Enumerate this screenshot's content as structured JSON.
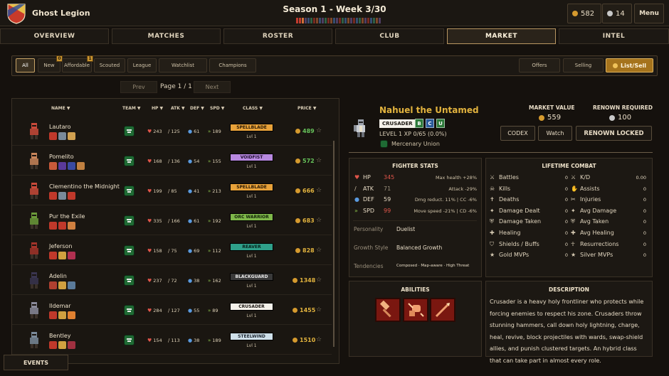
{
  "header": {
    "team_name": "Ghost Legion",
    "season_title": "Season 1 - Week 3/30",
    "gold": "582",
    "renown": "14",
    "menu_label": "Menu",
    "week_colors": [
      "#c23b2e",
      "#c23b2e",
      "#d0703a",
      "#7a5fa5",
      "#4a7bbf",
      "#3f9a6d",
      "#c23b2e",
      "#d0703a",
      "#4a7bbf",
      "#7a5fa5",
      "#3f9a6d",
      "#c23b2e",
      "#d0703a",
      "#4a7bbf",
      "#7a5fa5",
      "#c23b2e",
      "#3f9a6d",
      "#4a7bbf",
      "#d0703a",
      "#7a5fa5",
      "#c23b2e",
      "#4a7bbf",
      "#3f9a6d",
      "#d0703a",
      "#7a5fa5",
      "#c23b2e",
      "#4a7bbf",
      "#3f9a6d",
      "#d0703a",
      "#7a5fa5"
    ]
  },
  "tabs": [
    "OVERVIEW",
    "MATCHES",
    "ROSTER",
    "CLUB",
    "MARKET",
    "INTEL"
  ],
  "active_tab": "MARKET",
  "filters": {
    "all": "All",
    "new": "New",
    "new_badge": "0",
    "affordable": "Affordable",
    "affordable_badge": "1",
    "scouted": "Scouted",
    "league": "League",
    "watchlist": "Watchlist",
    "champions": "Champions",
    "offers": "Offers",
    "selling": "Selling",
    "list_sell": "List/Sell"
  },
  "pagination": {
    "prev": "Prev",
    "label": "Page 1 / 1",
    "next": "Next"
  },
  "table": {
    "headers": {
      "name": "NAME ▼",
      "team": "TEAM ▼",
      "hp": "HP ▼",
      "atk": "ATK ▼",
      "def": "DEF ▼",
      "spd": "SPD ▼",
      "class": "CLASS ▼",
      "price": "PRICE ▼"
    },
    "rows": [
      {
        "name": "Lautaro",
        "hp": "243",
        "atk": "125",
        "def": "61",
        "spd": "189",
        "class": "SPELLBLADE",
        "level": "Lvl 1",
        "price": "489",
        "class_color": "#e8a23a",
        "class_text": "#2a1a05",
        "price_color": "#66c25a",
        "skin": "#c94a3a"
      },
      {
        "name": "Pomelito",
        "hp": "168",
        "atk": "136",
        "def": "54",
        "spd": "155",
        "class": "VOIDFIST",
        "level": "Lvl 1",
        "price": "572",
        "class_color": "#b889e0",
        "class_text": "#1f0f30",
        "price_color": "#66c25a",
        "skin": "#c9855a"
      },
      {
        "name": "Clementino the Midnight",
        "hp": "199",
        "atk": "85",
        "def": "41",
        "spd": "213",
        "class": "SPELLBLADE",
        "level": "Lvl 1",
        "price": "666",
        "class_color": "#e8a23a",
        "class_text": "#2a1a05",
        "price_color": "#e2b33e",
        "skin": "#c94a3a"
      },
      {
        "name": "Pur the Exile",
        "hp": "335",
        "atk": "166",
        "def": "61",
        "spd": "192",
        "class": "ORC WARRIOR",
        "level": "Lvl 1",
        "price": "683",
        "class_color": "#7fb84a",
        "class_text": "#14250a",
        "price_color": "#e2b33e",
        "skin": "#6b9a3a"
      },
      {
        "name": "Jeferson",
        "hp": "158",
        "atk": "75",
        "def": "69",
        "spd": "112",
        "class": "REAVER",
        "level": "Lvl 1",
        "price": "828",
        "class_color": "#2fa08a",
        "class_text": "#06221c",
        "price_color": "#e2b33e",
        "skin": "#a3342a"
      },
      {
        "name": "Adelin",
        "hp": "237",
        "atk": "72",
        "def": "38",
        "spd": "162",
        "class": "BLACKGUARD",
        "level": "Lvl 1",
        "price": "1348",
        "class_color": "#3a3a3a",
        "class_text": "#e8e8e8",
        "price_color": "#e2b33e",
        "skin": "#3a3550"
      },
      {
        "name": "Ildemar",
        "hp": "284",
        "atk": "127",
        "def": "55",
        "spd": "89",
        "class": "CRUSADER",
        "level": "Lvl 1",
        "price": "1455",
        "class_color": "#f4f1ea",
        "class_text": "#1b1712",
        "price_color": "#e2b33e",
        "skin": "#8a8a9a"
      },
      {
        "name": "Bentley",
        "hp": "154",
        "atk": "113",
        "def": "38",
        "spd": "189",
        "class": "STEELWIND",
        "level": "Lvl 1",
        "price": "1510",
        "class_color": "#cfe0ea",
        "class_text": "#1b2530",
        "price_color": "#e2b33e",
        "skin": "#7a8a9a"
      }
    ]
  },
  "events_label": "EVENTS",
  "hero": {
    "name": "Nahuel the Untamed",
    "class": "CRUSADER",
    "grades": [
      "B",
      "C",
      "U"
    ],
    "level_line": "LEVEL 1  XP 0/65 (0.0%)",
    "team": "Mercenary Union",
    "market_value_label": "MARKET VALUE",
    "market_value": "559",
    "renown_label": "RENOWN REQUIRED",
    "renown": "100",
    "codex": "CODEX",
    "watch": "Watch",
    "renown_locked": "RENOWN LOCKED"
  },
  "fighter_stats": {
    "title": "FIGHTER STATS",
    "rows": [
      {
        "label": "HP",
        "value": "345",
        "note": "Max health +28%",
        "color": "#e0554a"
      },
      {
        "label": "ATK",
        "value": "71",
        "note": "Attack -29%",
        "color": "#9a8f7c"
      },
      {
        "label": "DEF",
        "value": "59",
        "note": "Dmg reduct. 11% | CC -6%",
        "color": "#e8dcc6"
      },
      {
        "label": "SPD",
        "value": "99",
        "note": "Move speed -21% | CD -6%",
        "color": "#e0554a"
      }
    ],
    "personality_label": "Personality",
    "personality": "Duelist",
    "growth_label": "Growth Style",
    "growth": "Balanced Growth",
    "tendencies_label": "Tendencies",
    "tendencies": "Composed · Map-aware · High Threat"
  },
  "lifetime": {
    "title": "LIFETIME COMBAT",
    "left": [
      {
        "label": "Battles",
        "value": "0",
        "icon": "⚔"
      },
      {
        "label": "Kills",
        "value": "0",
        "icon": "☠"
      },
      {
        "label": "Deaths",
        "value": "0",
        "icon": "✝"
      },
      {
        "label": "Damage Dealt",
        "value": "0",
        "icon": "✦"
      },
      {
        "label": "Damage Taken",
        "value": "0",
        "icon": "⛨"
      },
      {
        "label": "Healing",
        "value": "0",
        "icon": "✚"
      },
      {
        "label": "Shields / Buffs",
        "value": "0",
        "icon": "⛉"
      },
      {
        "label": "Gold MVPs",
        "value": "0",
        "icon": "★"
      }
    ],
    "right": [
      {
        "label": "K/D",
        "value": "0.00",
        "icon": "⚔"
      },
      {
        "label": "Assists",
        "value": "0",
        "icon": "✋"
      },
      {
        "label": "Injuries",
        "value": "0",
        "icon": "✂"
      },
      {
        "label": "Avg Damage",
        "value": "0",
        "icon": "✦"
      },
      {
        "label": "Avg Taken",
        "value": "0",
        "icon": "⛨"
      },
      {
        "label": "Avg Healing",
        "value": "0",
        "icon": "✚"
      },
      {
        "label": "Resurrections",
        "value": "0",
        "icon": "☥"
      },
      {
        "label": "Silver MVPs",
        "value": "0",
        "icon": "★"
      }
    ]
  },
  "abilities": {
    "title": "ABILITIES",
    "icons": [
      "hammer-icon",
      "fist-icon",
      "spear-icon"
    ]
  },
  "description": {
    "title": "DESCRIPTION",
    "text": "Crusader is a heavy holy frontliner who protects while forcing enemies to respect his zone. Crusaders throw stunning hammers, call down holy lightning, charge, heal, revive, block projectiles with wards, swap-shield allies, and punish clustered targets. An hybrid class that can take part in almost every role."
  },
  "colors": {
    "accent": "#e2b33e",
    "gold": "#d59a2e",
    "silver": "#c8c8c8"
  }
}
